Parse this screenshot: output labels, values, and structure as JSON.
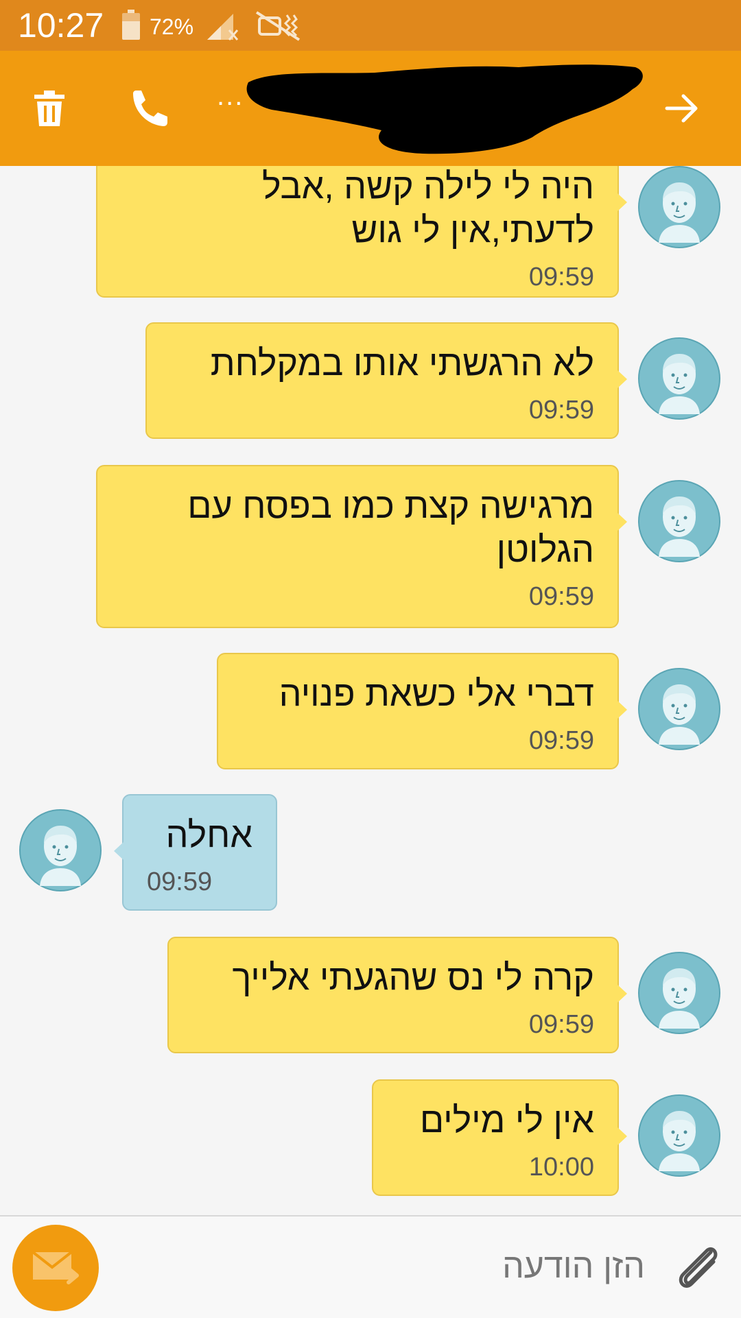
{
  "status_bar": {
    "time": "10:27",
    "battery_percent": "72%",
    "icons": [
      "battery-icon",
      "signal-icon",
      "mute-icon"
    ]
  },
  "app_bar": {
    "icons": [
      "trash-icon",
      "call-icon",
      "more-icon",
      "forward-icon"
    ],
    "more_label": "..."
  },
  "colors": {
    "status_bar": "#e0881c",
    "app_bar": "#f19b0f",
    "outgoing_bubble": "#fee262",
    "incoming_bubble": "#b3dce7",
    "avatar": "#7cbfcc"
  },
  "messages": [
    {
      "direction": "outgoing",
      "text": "היה לי לילה קשה ,אבל\nלדעתי,אין לי גוש",
      "time": "09:59"
    },
    {
      "direction": "outgoing",
      "text": "לא הרגשתי אותו במקלחת",
      "time": "09:59"
    },
    {
      "direction": "outgoing",
      "text": "מרגישה קצת כמו בפסח עם\nהגלוטן",
      "time": "09:59"
    },
    {
      "direction": "outgoing",
      "text": "דברי אלי כשאת פנויה",
      "time": "09:59"
    },
    {
      "direction": "incoming",
      "text": "אחלה",
      "time": "09:59"
    },
    {
      "direction": "outgoing",
      "text": "קרה לי נס שהגעתי אלייך",
      "time": "09:59"
    },
    {
      "direction": "outgoing",
      "text": "אין לי מילים",
      "time": "10:00"
    }
  ],
  "composer": {
    "placeholder": "הזן הודעה",
    "icons": [
      "send-icon",
      "attach-icon"
    ]
  }
}
